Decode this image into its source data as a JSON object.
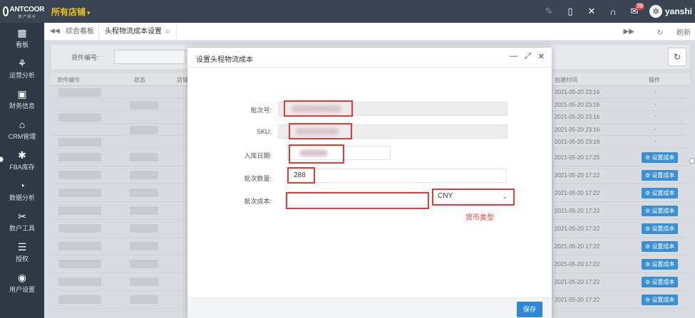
{
  "header": {
    "logo_text": "ANTCOOR",
    "logo_sub": "数 产 顾 手",
    "store": "所有店铺",
    "username": "yanshi",
    "mail_count": "39",
    "avatar_glyph": "✲"
  },
  "sidebar": {
    "items": [
      {
        "label": "看板",
        "icon": "dashboard-icon"
      },
      {
        "label": "运营分析",
        "icon": "analysis-icon"
      },
      {
        "label": "财务信息",
        "icon": "finance-icon"
      },
      {
        "label": "CRM管理",
        "icon": "crm-icon"
      },
      {
        "label": "FBA库存",
        "icon": "inventory-icon"
      },
      {
        "label": "数据分析",
        "icon": "data-icon"
      },
      {
        "label": "数户工具",
        "icon": "tools-icon"
      },
      {
        "label": "授权",
        "icon": "authorize-icon"
      },
      {
        "label": "用户设置",
        "icon": "user-settings-icon"
      }
    ]
  },
  "tabs": {
    "items": [
      {
        "label": "综合看板"
      },
      {
        "label": "头程物流成本设置"
      }
    ],
    "refresh_label": "刷新"
  },
  "filter": {
    "label": "货件编号:"
  },
  "table": {
    "headers": [
      "货件编号",
      "状态",
      "店铺",
      "创建时间",
      "操作"
    ],
    "rows": [
      {
        "time": "2021-05-20 23:16",
        "action": "-"
      },
      {
        "time": "2021-05-20 23:16",
        "action": "-"
      },
      {
        "time": "2021-05-20 23:16",
        "action": "-"
      },
      {
        "time": "2021-05-20 23:16",
        "action": "-"
      },
      {
        "time": "2021-05-20 23:16",
        "action": "-"
      },
      {
        "time": "2021-05-20 17:25",
        "action": "设置成本"
      },
      {
        "time": "2021-05-20 17:22",
        "action": "设置成本"
      },
      {
        "time": "2021-05-20 17:22",
        "action": "设置成本"
      },
      {
        "time": "2021-05-20 17:22",
        "action": "设置成本"
      },
      {
        "time": "2021-05-20 17:22",
        "action": "设置成本"
      },
      {
        "time": "2021-05-20 17:22",
        "action": "设置成本"
      },
      {
        "time": "2021-05-20 17:22",
        "action": "设置成本"
      },
      {
        "time": "2021-05-20 17:22",
        "action": "设置成本"
      },
      {
        "time": "2021-05-20 17:22",
        "action": "设置成本"
      }
    ]
  },
  "modal": {
    "title": "设置头程物流成本",
    "fields": {
      "batch_no_label": "批次号:",
      "sku_label": "SKU:",
      "date_label": "入库日期:",
      "qty_label": "批次数量:",
      "qty_value": "288",
      "cost_label": "批次成本:",
      "cost_value": ""
    },
    "currency": "CNY",
    "annotation": "货币类型",
    "save_label": "保存"
  },
  "colors": {
    "topbar": "#3a4452",
    "sidebar": "#2f3946",
    "store": "#f0c419",
    "highlight": "#e53935",
    "primary": "#2e88d6"
  }
}
